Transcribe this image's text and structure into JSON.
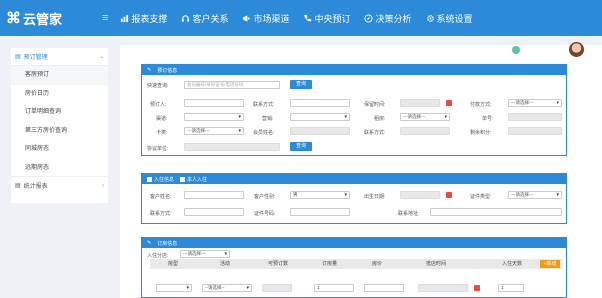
{
  "app": {
    "logo_mark": "⌘",
    "name": "云管家"
  },
  "nav": {
    "items": [
      {
        "icon": "bar-chart-icon",
        "label": "报表支撑"
      },
      {
        "icon": "headset-icon",
        "label": "客户关系"
      },
      {
        "icon": "megaphone-icon",
        "label": "市场渠道"
      },
      {
        "icon": "phone-icon",
        "label": "中央预订"
      },
      {
        "icon": "compass-icon",
        "label": "决策分析"
      },
      {
        "icon": "gear-icon",
        "label": "系统设置"
      }
    ]
  },
  "sidebar": {
    "group": "预订管理",
    "items": [
      "客房预订",
      "房价日历",
      "订单明细查询",
      "第三方房价查询",
      "同城房态",
      "远期房态"
    ],
    "footer": "统计报表"
  },
  "badge": {
    "count": "0"
  },
  "booking": {
    "title": "预订信息",
    "quick_label": "快速查询:",
    "quick_placeholder": "会员编号/身份证号/电话号码",
    "query_btn": "查询",
    "booker": "预订人:",
    "contact": "联系方式:",
    "keep_time": "保留时间:",
    "pay_method": "付款方式:",
    "channel": "渠道:",
    "market": "营销:",
    "agreement": "租房:",
    "order_no": "单号:",
    "card_type": "卡类:",
    "member_name": "会员姓名:",
    "phone": "联系方式:",
    "points": "剩余积分:",
    "unit": "协议单位:",
    "select_placeholder": "---请选择---"
  },
  "checkin": {
    "title": "入住信息",
    "checkbox_label": "本人入住",
    "guest_name": "客户姓名:",
    "gender": "客户性别:",
    "gender_value": "男",
    "birthday": "出生日期:",
    "id_type": "证件类型:",
    "contact": "联系方式:",
    "id_no": "证件号码:",
    "address": "联系地址:",
    "select_placeholder": "---请选择---"
  },
  "order": {
    "title": "订房信息",
    "branch_label": "入住分店:",
    "branch_placeholder": "---请选择---",
    "columns": [
      "房型",
      "活动",
      "可预订数",
      "订房量",
      "房价",
      "抵店时间",
      "入住天数"
    ],
    "add_btn": "+新增",
    "row": {
      "activity": "--请选择--",
      "qty": "1",
      "days": "1"
    }
  },
  "colors": {
    "primary": "#2d8ad8",
    "accent": "#f39c12",
    "calendar": "#e74c3c"
  }
}
